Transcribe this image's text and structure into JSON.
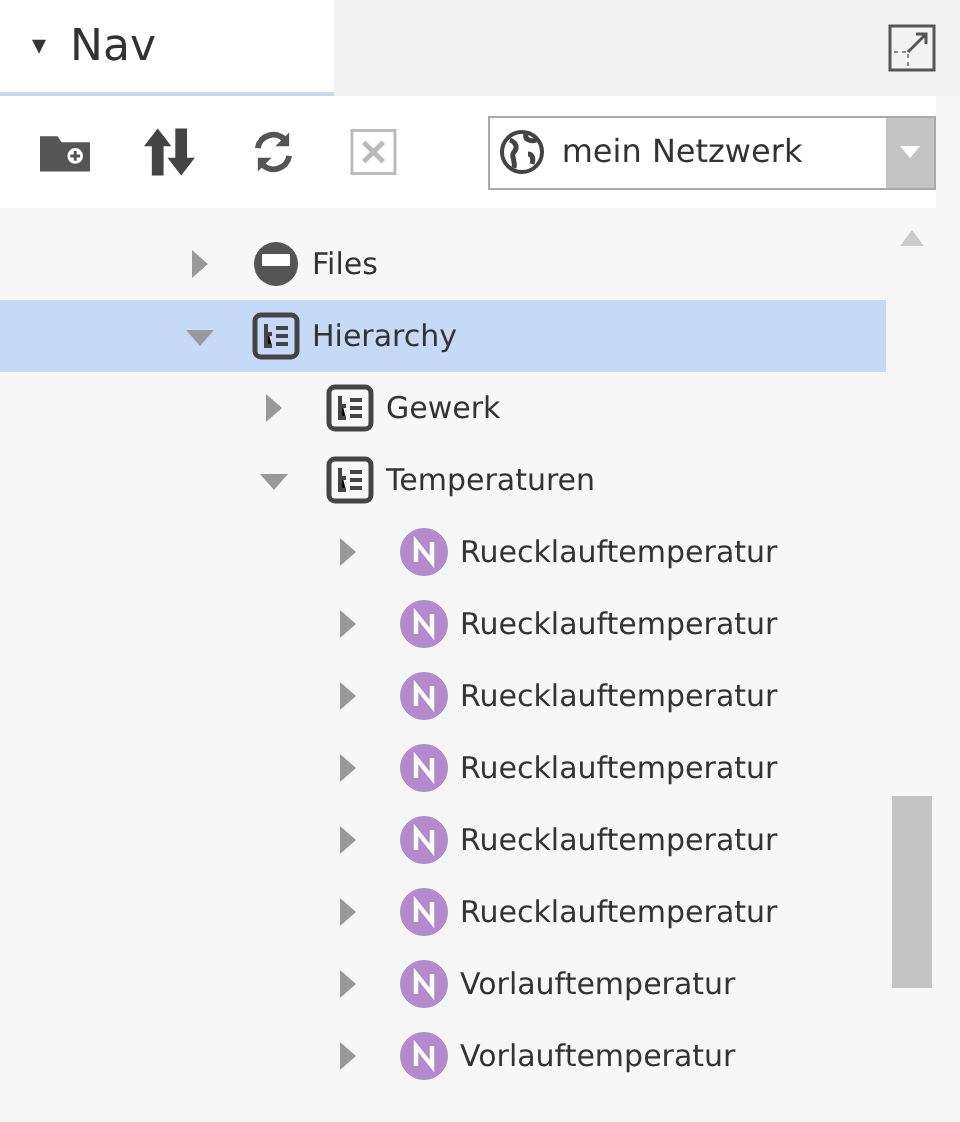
{
  "panel_tab": {
    "label": "Nav",
    "caret": "▾"
  },
  "toolbar": {
    "location": "mein Netzwerk"
  },
  "tree": [
    {
      "label": "Files",
      "kind": "drive",
      "expanded": false,
      "selected": false
    },
    {
      "label": "Hierarchy",
      "kind": "hierarchy",
      "expanded": true,
      "selected": true,
      "children": [
        {
          "label": "Gewerk",
          "kind": "hierarchy",
          "expanded": false,
          "selected": false
        },
        {
          "label": "Temperaturen",
          "kind": "hierarchy",
          "expanded": true,
          "selected": false,
          "children": [
            {
              "label": "Ruecklauftemperatur",
              "kind": "node",
              "expanded": false,
              "selected": false
            },
            {
              "label": "Ruecklauftemperatur",
              "kind": "node",
              "expanded": false,
              "selected": false
            },
            {
              "label": "Ruecklauftemperatur",
              "kind": "node",
              "expanded": false,
              "selected": false
            },
            {
              "label": "Ruecklauftemperatur",
              "kind": "node",
              "expanded": false,
              "selected": false
            },
            {
              "label": "Ruecklauftemperatur",
              "kind": "node",
              "expanded": false,
              "selected": false
            },
            {
              "label": "Ruecklauftemperatur",
              "kind": "node",
              "expanded": false,
              "selected": false
            },
            {
              "label": "Vorlauftemperatur",
              "kind": "node",
              "expanded": false,
              "selected": false
            },
            {
              "label": "Vorlauftemperatur",
              "kind": "node",
              "expanded": false,
              "selected": false
            }
          ]
        }
      ]
    }
  ]
}
